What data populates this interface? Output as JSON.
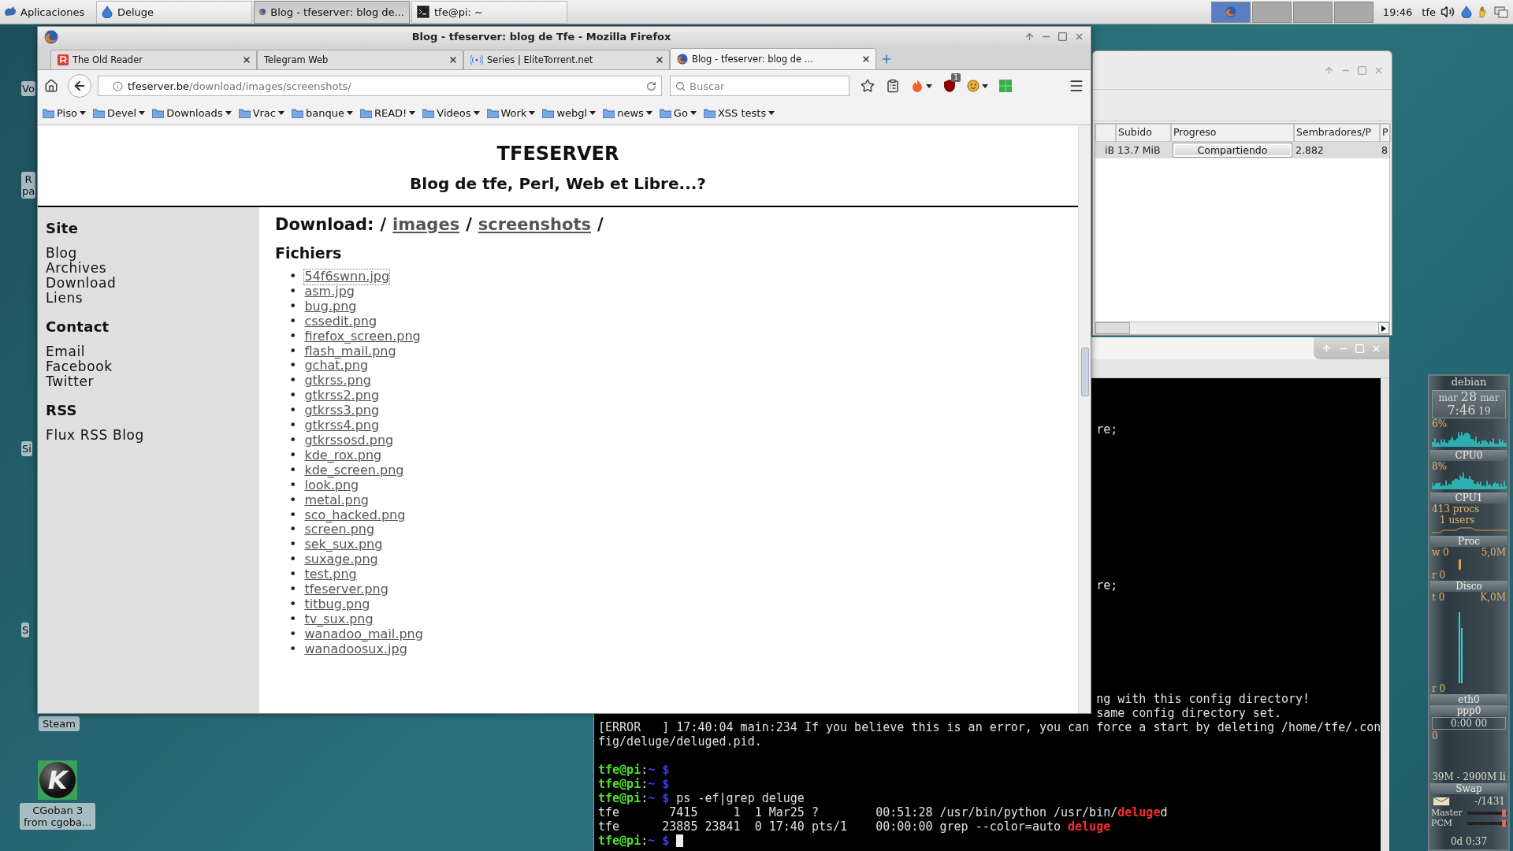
{
  "panel": {
    "menu_label": "Aplicaciones",
    "tasks": [
      {
        "label": "Deluge",
        "selected": false
      },
      {
        "label": "Blog - tfeserver: blog de...",
        "selected": true
      },
      {
        "label": "tfe@pi: ~",
        "selected": false
      }
    ],
    "workspaces": [
      {
        "selected": true
      },
      {
        "selected": false
      },
      {
        "selected": false
      },
      {
        "selected": false
      }
    ],
    "clock": "19:46",
    "user": "tfe"
  },
  "desktop_icons": [
    {
      "kind": "partial",
      "lines": [
        "Vo"
      ]
    },
    {
      "kind": "partial",
      "lines": [
        "R",
        "pa"
      ]
    },
    {
      "kind": "partial",
      "lines": [
        "Si"
      ]
    },
    {
      "kind": "partial",
      "lines": [
        "S"
      ]
    },
    {
      "kind": "label",
      "lines": [
        "Steam"
      ]
    },
    {
      "kind": "app",
      "glyph": "K",
      "lines": [
        "CGoban 3",
        "from cgoba..."
      ]
    }
  ],
  "firefox": {
    "title": "Blog - tfeserver: blog de Tfe - Mozilla Firefox",
    "tabs": [
      {
        "label": "The Old Reader",
        "selected": false
      },
      {
        "label": "Telegram Web",
        "selected": false
      },
      {
        "label": "Series | EliteTorrent.net",
        "selected": false
      },
      {
        "label": "Blog - tfeserver: blog de ...",
        "selected": true
      }
    ],
    "url_host": "tfeserver.be",
    "url_path": "/download/images/screenshots/",
    "search_placeholder": "Buscar",
    "addon_badge": "1",
    "bookmarks": [
      "Piso",
      "Devel",
      "Downloads",
      "Vrac",
      "banque",
      "READ!",
      "Videos",
      "Work",
      "webgl",
      "news",
      "Go",
      "XSS tests"
    ],
    "page": {
      "site_title": "TFESERVER",
      "tagline": "Blog de tfe, Perl, Web et Libre...?",
      "sidebar": [
        {
          "heading": "Site",
          "links": [
            "Blog",
            "Archives",
            "Download",
            "Liens"
          ]
        },
        {
          "heading": "Contact",
          "links": [
            "Email",
            "Facebook",
            "Twitter"
          ]
        },
        {
          "heading": "RSS",
          "links": [
            "Flux RSS Blog"
          ]
        }
      ],
      "breadcrumb": {
        "label": "Download:",
        "separator": "/",
        "links": [
          "images",
          "screenshots"
        ]
      },
      "files_heading": "Fichiers",
      "bullet": "•",
      "files": [
        {
          "name": "54f6swnn.jpg",
          "focused": true
        },
        {
          "name": "asm.jpg",
          "focused": false
        },
        {
          "name": "bug.png",
          "focused": false
        },
        {
          "name": "cssedit.png",
          "focused": false
        },
        {
          "name": "firefox_screen.png",
          "focused": false
        },
        {
          "name": "flash_mail.png",
          "focused": false
        },
        {
          "name": "gchat.png",
          "focused": false
        },
        {
          "name": "gtkrss.png",
          "focused": false
        },
        {
          "name": "gtkrss2.png",
          "focused": false
        },
        {
          "name": "gtkrss3.png",
          "focused": false
        },
        {
          "name": "gtkrss4.png",
          "focused": false
        },
        {
          "name": "gtkrssosd.png",
          "focused": false
        },
        {
          "name": "kde_rox.png",
          "focused": false
        },
        {
          "name": "kde_screen.png",
          "focused": false
        },
        {
          "name": "look.png",
          "focused": false
        },
        {
          "name": "metal.png",
          "focused": false
        },
        {
          "name": "sco_hacked.png",
          "focused": false
        },
        {
          "name": "screen.png",
          "focused": false
        },
        {
          "name": "sek_sux.png",
          "focused": false
        },
        {
          "name": "suxage.png",
          "focused": false
        },
        {
          "name": "test.png",
          "focused": false
        },
        {
          "name": "tfeserver.png",
          "focused": false
        },
        {
          "name": "titbug.png",
          "focused": false
        },
        {
          "name": "tv_sux.png",
          "focused": false
        },
        {
          "name": "wanadoo_mail.png",
          "focused": false
        },
        {
          "name": "wanadoosux.jpg",
          "focused": false
        }
      ]
    }
  },
  "deluge": {
    "columns": [
      {
        "label": "Subido"
      },
      {
        "label": "Progreso"
      },
      {
        "label": "Sembradores/P"
      },
      {
        "label": "P"
      }
    ],
    "row": {
      "cells": [
        "iB",
        "13.7 MiB",
        "Compartiendo",
        "2.882",
        "8"
      ],
      "level": 1,
      "selected": true
    }
  },
  "terminal": {
    "lines": [
      {
        "kind": "blank"
      },
      {
        "kind": "blank"
      },
      {
        "kind": "blank"
      },
      {
        "kind": "tail",
        "segments": [
          {
            "text": "re;",
            "kind": "plain"
          }
        ]
      },
      {
        "kind": "blank"
      },
      {
        "kind": "blank"
      },
      {
        "kind": "blank"
      },
      {
        "kind": "blank"
      },
      {
        "kind": "blank"
      },
      {
        "kind": "blank"
      },
      {
        "kind": "blank"
      },
      {
        "kind": "blank"
      },
      {
        "kind": "blank"
      },
      {
        "kind": "blank"
      },
      {
        "kind": "tail",
        "segments": [
          {
            "text": "re;",
            "kind": "plain"
          }
        ]
      },
      {
        "kind": "blank"
      },
      {
        "kind": "blank"
      },
      {
        "kind": "blank"
      },
      {
        "kind": "blank"
      },
      {
        "kind": "blank"
      },
      {
        "kind": "blank"
      },
      {
        "kind": "blank"
      },
      {
        "kind": "tail",
        "segments": [
          {
            "text": "ng with this config directory!",
            "kind": "plain"
          }
        ]
      },
      {
        "kind": "tail",
        "segments": [
          {
            "text": "same config directory set.",
            "kind": "plain"
          }
        ]
      },
      {
        "kind": "full",
        "segments": [
          {
            "text": "[ERROR   ] 17:40:04 main:234 If you believe this is an error, you can force a start by deleting /home/tfe/.con",
            "kind": "plain"
          }
        ]
      },
      {
        "kind": "full",
        "segments": [
          {
            "text": "fig/deluge/deluged.pid.",
            "kind": "plain"
          }
        ]
      },
      {
        "kind": "blank"
      },
      {
        "kind": "full",
        "segments": [
          {
            "text": "tfe@pi",
            "kind": "user"
          },
          {
            "text": ":",
            "kind": "plain"
          },
          {
            "text": "~ $",
            "kind": "path"
          }
        ]
      },
      {
        "kind": "full",
        "segments": [
          {
            "text": "tfe@pi",
            "kind": "user"
          },
          {
            "text": ":",
            "kind": "plain"
          },
          {
            "text": "~ $",
            "kind": "path"
          }
        ]
      },
      {
        "kind": "full",
        "segments": [
          {
            "text": "tfe@pi",
            "kind": "user"
          },
          {
            "text": ":",
            "kind": "plain"
          },
          {
            "text": "~ $",
            "kind": "path"
          },
          {
            "text": " ps -ef|grep deluge",
            "kind": "plain"
          }
        ]
      },
      {
        "kind": "full",
        "segments": [
          {
            "text": "tfe       7415     1  1 Mar25 ?        00:51:28 /usr/bin/python /usr/bin/",
            "kind": "plain"
          },
          {
            "text": "deluge",
            "kind": "match"
          },
          {
            "text": "d",
            "kind": "plain"
          }
        ]
      },
      {
        "kind": "full",
        "segments": [
          {
            "text": "tfe      23885 23841  0 17:40 pts/1    00:00:00 grep --color=auto ",
            "kind": "plain"
          },
          {
            "text": "deluge",
            "kind": "match"
          }
        ]
      },
      {
        "kind": "full",
        "cursor": true,
        "segments": [
          {
            "text": "tfe@pi",
            "kind": "user"
          },
          {
            "text": ":",
            "kind": "plain"
          },
          {
            "text": "~ $",
            "kind": "path"
          }
        ]
      }
    ]
  },
  "conky": {
    "host": "debian",
    "date": [
      "mar",
      "28",
      "mar"
    ],
    "time": [
      "7:46",
      "19"
    ],
    "sections": [
      {
        "kind": "cpu",
        "reading": "6%",
        "label": "CPU0"
      },
      {
        "kind": "cpu",
        "reading": "8%",
        "label": "CPU1"
      },
      {
        "kind": "proc",
        "lines": [
          "413 procs",
          "1 users"
        ],
        "label": "Proc"
      },
      {
        "kind": "disk",
        "top_left": "w 0",
        "top_right": "5,0M",
        "bottom_left": "r 0",
        "label": "Disco"
      },
      {
        "kind": "net",
        "top_left": "t 0",
        "top_right": "K,0M",
        "bottom_left": "r 0",
        "label": "eth0"
      }
    ],
    "ppp": "ppp0",
    "timer": "0:00 00",
    "graph_reading": "0",
    "memory": "39M - 2900M li",
    "swap": "Swap",
    "mail": "-/1431",
    "mixer": [
      {
        "label": "Master",
        "level": 0.97
      },
      {
        "label": "PCM",
        "level": 0.97
      }
    ],
    "uptime": "0d 0:37"
  }
}
